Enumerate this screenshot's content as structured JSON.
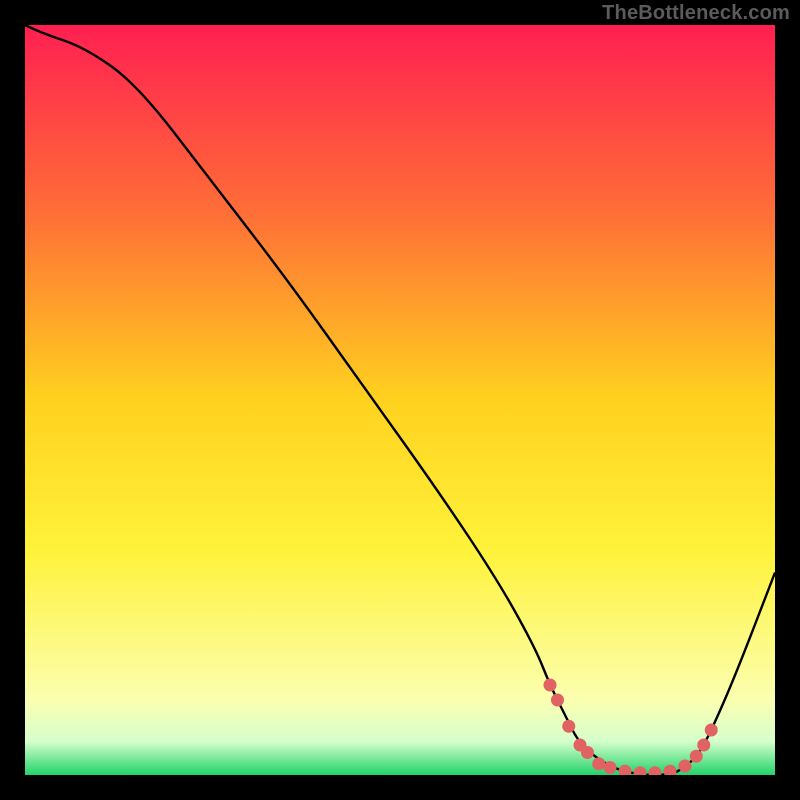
{
  "attribution": "TheBottleneck.com",
  "chart_data": {
    "type": "line",
    "title": "",
    "xlabel": "",
    "ylabel": "",
    "xlim": [
      0,
      100
    ],
    "ylim": [
      0,
      100
    ],
    "grid": false,
    "legend": false,
    "background_gradient": [
      {
        "pos": 0.0,
        "color": "#ff1f52"
      },
      {
        "pos": 0.25,
        "color": "#ff6e37"
      },
      {
        "pos": 0.5,
        "color": "#ffd21f"
      },
      {
        "pos": 0.7,
        "color": "#fff23a"
      },
      {
        "pos": 0.9,
        "color": "#fbffb0"
      },
      {
        "pos": 0.955,
        "color": "#d6ffcc"
      },
      {
        "pos": 1.0,
        "color": "#22d36a"
      }
    ],
    "series": [
      {
        "name": "bottleneck-curve",
        "color": "#000000",
        "x": [
          0,
          2,
          8,
          15,
          25,
          35,
          45,
          55,
          63,
          68,
          70,
          72,
          74,
          78,
          82,
          86,
          88,
          90,
          92,
          95,
          100
        ],
        "y": [
          100,
          99,
          97,
          92,
          79,
          66,
          52,
          38,
          26,
          17,
          12,
          8,
          4,
          1,
          0,
          0,
          1,
          3,
          7,
          14,
          27
        ]
      }
    ],
    "markers": {
      "name": "highlight-dots",
      "color": "#e06262",
      "points": [
        {
          "x": 70.0,
          "y": 12.0
        },
        {
          "x": 71.0,
          "y": 10.0
        },
        {
          "x": 72.5,
          "y": 6.5
        },
        {
          "x": 74.0,
          "y": 4.0
        },
        {
          "x": 75.0,
          "y": 3.0
        },
        {
          "x": 76.5,
          "y": 1.5
        },
        {
          "x": 78.0,
          "y": 1.0
        },
        {
          "x": 80.0,
          "y": 0.5
        },
        {
          "x": 82.0,
          "y": 0.3
        },
        {
          "x": 84.0,
          "y": 0.3
        },
        {
          "x": 86.0,
          "y": 0.5
        },
        {
          "x": 88.0,
          "y": 1.2
        },
        {
          "x": 89.5,
          "y": 2.5
        },
        {
          "x": 90.5,
          "y": 4.0
        },
        {
          "x": 91.5,
          "y": 6.0
        }
      ]
    }
  }
}
